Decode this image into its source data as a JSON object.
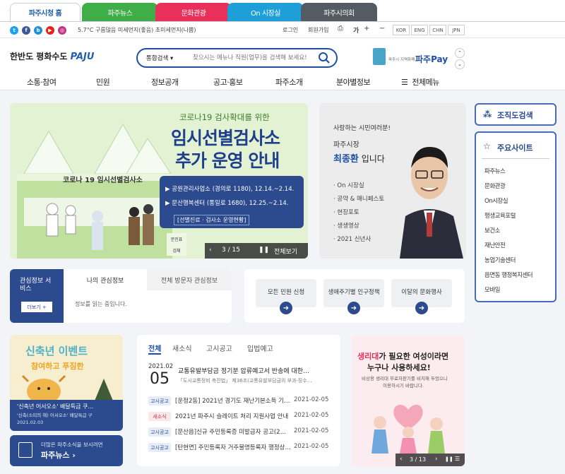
{
  "site_tabs": [
    {
      "label": "파주시청 홈",
      "color": "#ffffff"
    },
    {
      "label": "파주뉴스",
      "color": "#3fae49"
    },
    {
      "label": "문화관광",
      "color": "#e8305a"
    },
    {
      "label": "On 시장실",
      "color": "#1e9fd8"
    },
    {
      "label": "파주시의회",
      "color": "#555b63"
    }
  ],
  "util": {
    "weather": "5.7°C 구름많음 미세먼지(좋음) 초미세먼지(나쁨)",
    "login": "로그인",
    "join": "회원가입",
    "font_label": "가",
    "plus": "+",
    "minus": "−",
    "langs": [
      "KOR",
      "ENG",
      "CHN",
      "JPN"
    ]
  },
  "header": {
    "logo_text": "한반도 평화수도",
    "logo_brand": "PAJU",
    "search_select": "통합검색",
    "search_placeholder": "찾으시는 메뉴나 직원(업무)을 검색해 보세요!",
    "pay_small": "파주시 지역화폐",
    "pay_brand": "파주Pay"
  },
  "nav": {
    "items": [
      "소통·참여",
      "민원",
      "정보공개",
      "공고·홍보",
      "파주소개",
      "분야별정보"
    ],
    "all_menu": "전체메뉴"
  },
  "banner": {
    "subtitle": "코로나19 검사확대를 위한",
    "title1": "임시선별검사소",
    "title2": "추가 운영 안내",
    "sign": "코로나 19  임시선별검사소",
    "items": [
      {
        "place": "공원관리사업소 (경의로 1180),",
        "date": "12.14.~2.14."
      },
      {
        "place": "문산행복센터 (통일로 1680),",
        "date": "12.25.~2.14."
      }
    ],
    "note": "[선별진료 · 검사소 운영현황]",
    "page": "3 / 15",
    "view_all": "전체보기",
    "ops": [
      "문진표",
      "검체",
      "안내"
    ]
  },
  "mayor": {
    "greeting": "사랑하는 시민여러분!",
    "role": "파주시장",
    "name": "최종환",
    "suffix": "입니다",
    "links": [
      "On 시장실",
      "공약 & 매니페스토",
      "현장포토",
      "생생영상",
      "2021 신년사"
    ]
  },
  "org_search": "조직도검색",
  "main_sites": {
    "title": "주요사이트",
    "items": [
      "파주뉴스",
      "문화관광",
      "On시장실",
      "평생교육포털",
      "보건소",
      "재난안전",
      "농업기술센터",
      "읍면동 행정복지센터",
      "모바일"
    ]
  },
  "interest": {
    "title": "관심정보 서비스",
    "more": "더보기 +",
    "tabs": [
      "나의 관심정보",
      "전체 방문자 관심정보"
    ],
    "empty": "정보를 읽는 중입니다."
  },
  "quick": [
    "모든 민원 신청",
    "생애주기별 인구정책",
    "이달의 문화행사"
  ],
  "event": {
    "title1": "신축년 이벤트",
    "title2": "참여하고 푸짐한",
    "caption1": "'신축년 어서오소' 배달특급 쿠…",
    "caption2": "'신축(소띠의 해) 어서오소' 배달특급 구",
    "date": "2021.02.03"
  },
  "news_banner": {
    "line": "더많은 파주소식을 보시려면",
    "brand": "파주뉴스"
  },
  "notices": {
    "tabs": [
      "전체",
      "새소식",
      "고시공고",
      "입법예고"
    ],
    "featured": {
      "month": "2021.02",
      "day": "05",
      "title": "교통유발부담금 정기분 압류예고서 반송에 대한…",
      "desc": "「도시교통정비 촉진법」 제36조(교통유발부담금의 부과·징수…"
    },
    "rows": [
      {
        "tag": "고시공고",
        "title": "[운정2동] 2021년 경기도 재난기본소득 기…",
        "date": "2021-02-05"
      },
      {
        "tag": "새소식",
        "title": "2021년 파주시 슬레이트 처리 지원사업 안내",
        "date": "2021-02-05"
      },
      {
        "tag": "고시공고",
        "title": "[문산읍]신규 주민등록증 미발급자 공고(2…",
        "date": "2021-02-05"
      },
      {
        "tag": "고시공고",
        "title": "[탄현면] 주민등록자 거주불명등록자 행정상…",
        "date": "2021-02-05"
      }
    ]
  },
  "promo": {
    "line1a": "생리대",
    "line1b": "가 필요한 여성",
    "line1c": "이라면",
    "line2": "누구나 사용하세요!",
    "desc1": "비상용 생리대 무료자판기를 비치해 두었으니",
    "desc2": "이용하시기 바랍니다.",
    "page": "3 / 13"
  }
}
